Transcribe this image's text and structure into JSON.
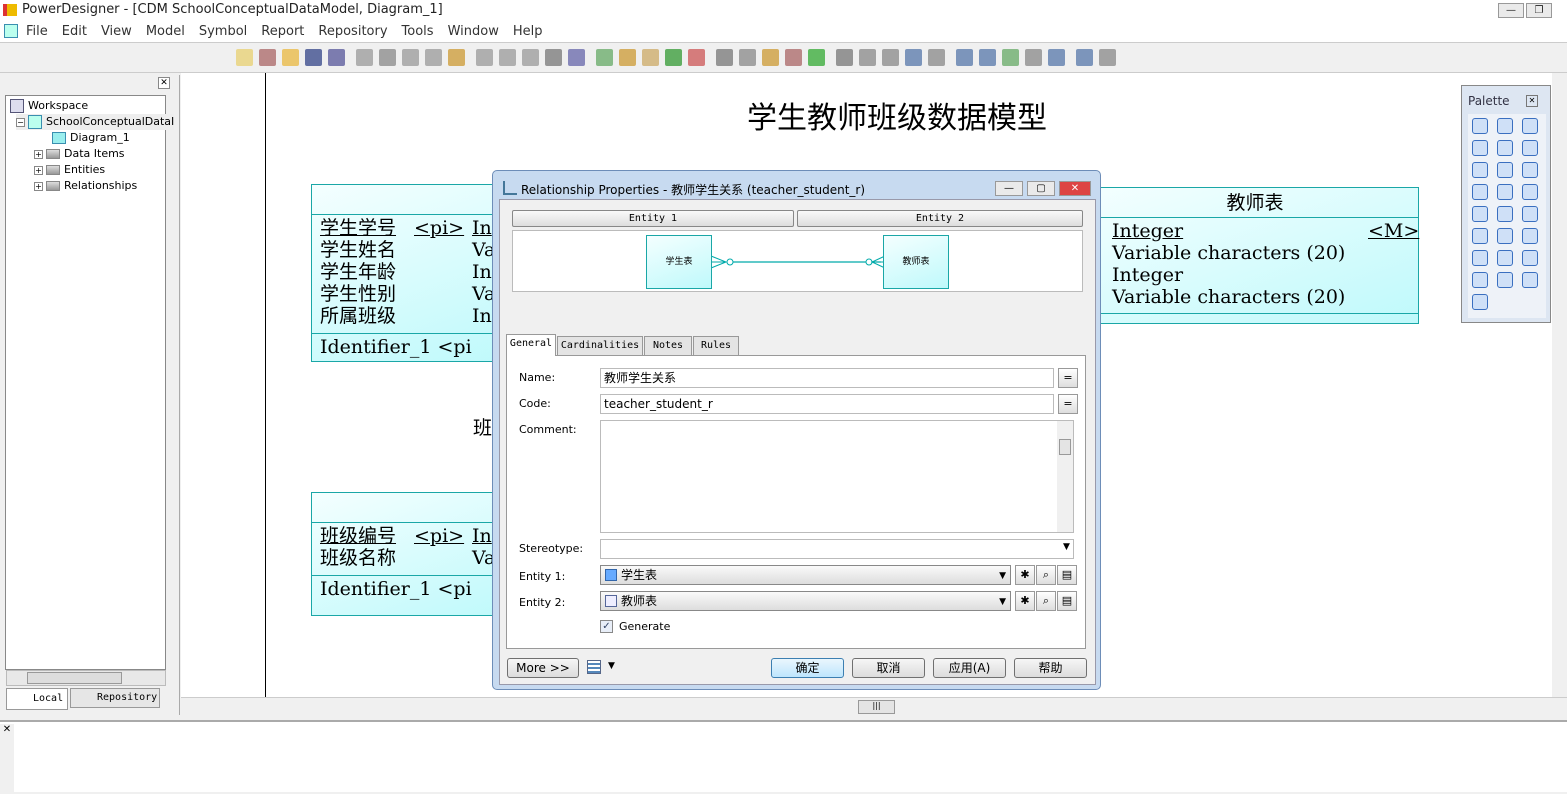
{
  "window": {
    "title": "PowerDesigner - [CDM SchoolConceptualDataModel, Diagram_1]"
  },
  "menu": [
    "File",
    "Edit",
    "View",
    "Model",
    "Symbol",
    "Report",
    "Repository",
    "Tools",
    "Window",
    "Help"
  ],
  "browser": {
    "tree": [
      {
        "label": "Workspace"
      },
      {
        "label": "SchoolConceptualDataI"
      },
      {
        "label": "Diagram_1"
      },
      {
        "label": "Data Items"
      },
      {
        "label": "Entities"
      },
      {
        "label": "Relationships"
      }
    ],
    "tabs": [
      "Local",
      "Repository"
    ]
  },
  "diagram": {
    "title": "学生教师班级数据模型",
    "partial_label": "班",
    "student": {
      "rows": [
        [
          "学生学号",
          "<pi>",
          "In"
        ],
        [
          "学生姓名",
          "",
          "Va"
        ],
        [
          "学生年龄",
          "",
          "In"
        ],
        [
          "学生性别",
          "",
          "Va"
        ],
        [
          "所属班级",
          "",
          "In"
        ]
      ],
      "identifier": "Identifier_1 <pi"
    },
    "teacher": {
      "name": "教师表",
      "rows": [
        [
          "Integer",
          "<M>"
        ],
        [
          "Variable characters (20)",
          ""
        ],
        [
          "Integer",
          ""
        ],
        [
          "Variable characters (20)",
          ""
        ]
      ]
    },
    "class": {
      "rows": [
        [
          "班级编号",
          "<pi>",
          "In"
        ],
        [
          "班级名称",
          "",
          "Va"
        ]
      ],
      "identifier": "Identifier_1 <pi"
    }
  },
  "palette": {
    "title": "Palette"
  },
  "dialog": {
    "title": "Relationship Properties - 教师学生关系 (teacher_student_r)",
    "entity1_header": "Entity 1",
    "entity2_header": "Entity 2",
    "preview_entity1": "学生表",
    "preview_entity2": "教师表",
    "tabs": [
      "General",
      "Cardinalities",
      "Notes",
      "Rules"
    ],
    "fields": {
      "name_label": "Name:",
      "name": "教师学生关系",
      "code_label": "Code:",
      "code": "teacher_student_r",
      "comment_label": "Comment:",
      "comment": "",
      "stereotype_label": "Stereotype:",
      "stereotype": "",
      "entity1_label": "Entity 1:",
      "entity1": "学生表",
      "entity2_label": "Entity 2:",
      "entity2": "教师表",
      "generate_label": "Generate",
      "generate": true
    },
    "buttons": {
      "more": "More >>",
      "ok": "确定",
      "cancel": "取消",
      "apply": "应用(A)",
      "help": "帮助"
    }
  },
  "colors": {
    "entity_border": "#1aa7a7",
    "entity_fill": "#bff9fb"
  }
}
